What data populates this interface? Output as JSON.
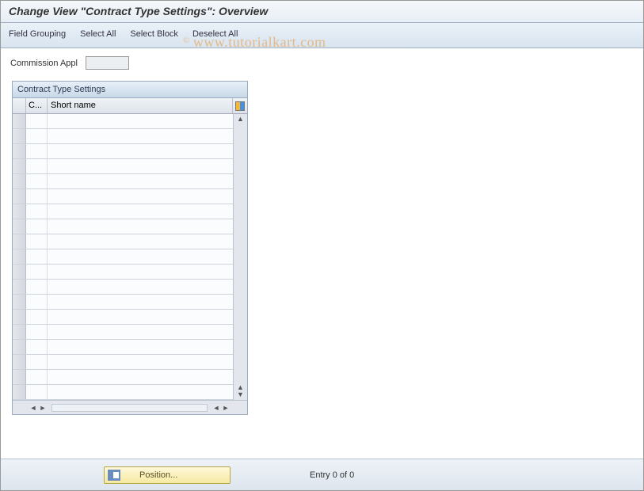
{
  "title": "Change View \"Contract Type Settings\": Overview",
  "toolbar": {
    "field_grouping": "Field Grouping",
    "select_all": "Select All",
    "select_block": "Select Block",
    "deselect_all": "Deselect All"
  },
  "watermark": "www.tutorialkart.com",
  "field": {
    "commission_appl_label": "Commission Appl",
    "commission_appl_value": ""
  },
  "panel": {
    "title": "Contract Type Settings",
    "columns": {
      "c": "C...",
      "short_name": "Short name"
    }
  },
  "footer": {
    "position_label": "Position...",
    "entry_text": "Entry 0 of 0"
  }
}
